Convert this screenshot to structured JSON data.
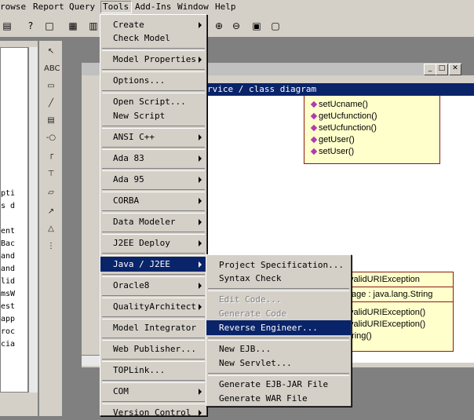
{
  "menubar": [
    "rowse",
    "Report",
    "Query",
    "Tools",
    "Add-Ins",
    "Window",
    "Help"
  ],
  "browser_items": [
    "pti",
    "s d",
    "",
    "ent",
    "Bac",
    "and",
    "and",
    "lid",
    "msW",
    "est",
    "app",
    "roc",
    "cia"
  ],
  "diagram_title": "rvice / class diagram",
  "class1_ops": [
    "setUcname()",
    "getUcfunction()",
    "setUcfunction()",
    "getUser()",
    "setUser()"
  ],
  "class2": {
    "name": "validURIException",
    "attr": "ssage : java.lang.String",
    "ops": [
      "validURIException()",
      "validURIException()",
      "tring()"
    ]
  },
  "tools_menu": [
    {
      "label": "Create",
      "sub": true
    },
    {
      "label": "Check Model",
      "sub": false
    },
    {
      "label": "Model Properties",
      "sub": true
    },
    {
      "label": "Options...",
      "sub": false
    },
    {
      "label": "Open Script...",
      "sub": false
    },
    {
      "label": "New Script",
      "sub": false
    },
    {
      "label": "ANSI C++",
      "sub": true
    },
    {
      "label": "Ada 83",
      "sub": true
    },
    {
      "label": "Ada 95",
      "sub": true
    },
    {
      "label": "CORBA",
      "sub": true
    },
    {
      "label": "Data Modeler",
      "sub": true
    },
    {
      "label": "J2EE Deploy",
      "sub": true
    },
    {
      "label": "Java / J2EE",
      "sub": true
    },
    {
      "label": "Oracle8",
      "sub": true
    },
    {
      "label": "QualityArchitect",
      "sub": true
    },
    {
      "label": "Model Integrator",
      "sub": false
    },
    {
      "label": "Web Publisher...",
      "sub": false
    },
    {
      "label": "TOPLink...",
      "sub": false
    },
    {
      "label": "COM",
      "sub": true
    },
    {
      "label": "Version Control",
      "sub": true
    }
  ],
  "java_menu": [
    {
      "label": "Project Specification...",
      "disabled": false
    },
    {
      "label": "Syntax Check",
      "disabled": false
    },
    {
      "label": "Edit Code...",
      "disabled": true
    },
    {
      "label": "Generate Code",
      "disabled": true
    },
    {
      "label": "Reverse Engineer...",
      "disabled": false
    },
    {
      "label": "New EJB...",
      "disabled": false
    },
    {
      "label": "New Servlet...",
      "disabled": false
    },
    {
      "label": "Generate EJB-JAR File",
      "disabled": false
    },
    {
      "label": "Generate WAR File",
      "disabled": false
    }
  ]
}
